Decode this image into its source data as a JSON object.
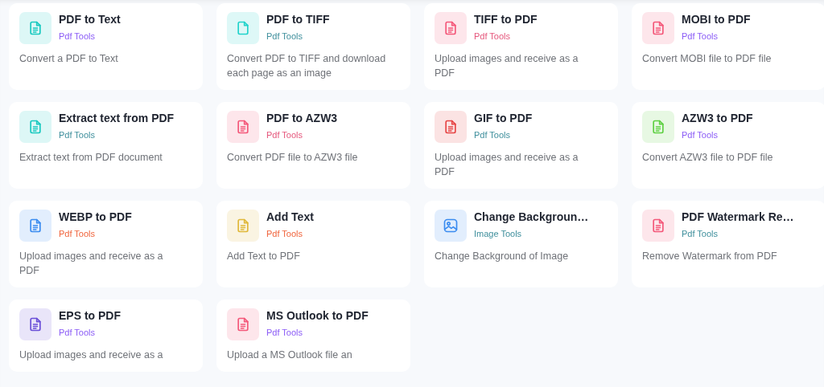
{
  "tools": [
    {
      "title": "PDF to Text",
      "category": {
        "text": "Pdf Tools",
        "color": "#8b5cf6"
      },
      "icon": {
        "kind": "document",
        "color": "#19c9c0"
      },
      "description": "Convert a PDF to Text"
    },
    {
      "title": "PDF to TIFF",
      "category": {
        "text": "Pdf Tools",
        "color": "#3f8f9c"
      },
      "icon": {
        "kind": "blank",
        "color": "#22d3cb"
      },
      "description": "Convert PDF to TIFF and download each page as an image"
    },
    {
      "title": "TIFF to PDF",
      "category": {
        "text": "Pdf Tools",
        "color": "#e5577c"
      },
      "icon": {
        "kind": "document",
        "color": "#f4587a"
      },
      "description": "Upload images and receive as a PDF"
    },
    {
      "title": "MOBI to PDF",
      "category": {
        "text": "Pdf Tools",
        "color": "#8b5cf6"
      },
      "icon": {
        "kind": "document",
        "color": "#f4587a"
      },
      "description": "Convert MOBI file to PDF file"
    },
    {
      "title": "Extract text from PDF",
      "category": {
        "text": "Pdf Tools",
        "color": "#3f8f9c"
      },
      "icon": {
        "kind": "document",
        "color": "#19c9c0"
      },
      "description": "Extract text from PDF document"
    },
    {
      "title": "PDF to AZW3",
      "category": {
        "text": "Pdf Tools",
        "color": "#e5577c"
      },
      "icon": {
        "kind": "document",
        "color": "#f4587a"
      },
      "description": "Convert PDF file to AZW3 file"
    },
    {
      "title": "GIF to PDF",
      "category": {
        "text": "Pdf Tools",
        "color": "#3f8f9c"
      },
      "icon": {
        "kind": "document",
        "color": "#e64545"
      },
      "description": "Upload images and receive as a PDF"
    },
    {
      "title": "AZW3 to PDF",
      "category": {
        "text": "Pdf Tools",
        "color": "#8b5cf6"
      },
      "icon": {
        "kind": "document",
        "color": "#5fd043"
      },
      "description": "Convert AZW3 file to PDF file"
    },
    {
      "title": "WEBP to PDF",
      "category": {
        "text": "Pdf Tools",
        "color": "#f0643c"
      },
      "icon": {
        "kind": "document",
        "color": "#3b8cf0"
      },
      "description": "Upload images and receive as a PDF"
    },
    {
      "title": "Add Text",
      "category": {
        "text": "Pdf Tools",
        "color": "#f0643c"
      },
      "icon": {
        "kind": "document",
        "color": "#e0b83a"
      },
      "description": "Add Text to PDF"
    },
    {
      "title": "Change Backgroun…",
      "category": {
        "text": "Image Tools",
        "color": "#3f8f9c"
      },
      "icon": {
        "kind": "image",
        "color": "#3b8cf0"
      },
      "description": "Change Background of Image"
    },
    {
      "title": "PDF Watermark Re…",
      "category": {
        "text": "Pdf Tools",
        "color": "#3f8f9c"
      },
      "icon": {
        "kind": "document",
        "color": "#f4587a"
      },
      "description": "Remove Watermark from PDF"
    },
    {
      "title": "EPS to PDF",
      "category": {
        "text": "Pdf Tools",
        "color": "#8b5cf6"
      },
      "icon": {
        "kind": "document",
        "color": "#6a4fd8"
      },
      "description": "Upload images and receive as a"
    },
    {
      "title": "MS Outlook to PDF",
      "category": {
        "text": "Pdf Tools",
        "color": "#8b5cf6"
      },
      "icon": {
        "kind": "document",
        "color": "#f4587a"
      },
      "description": "Upload a MS Outlook file an"
    }
  ]
}
